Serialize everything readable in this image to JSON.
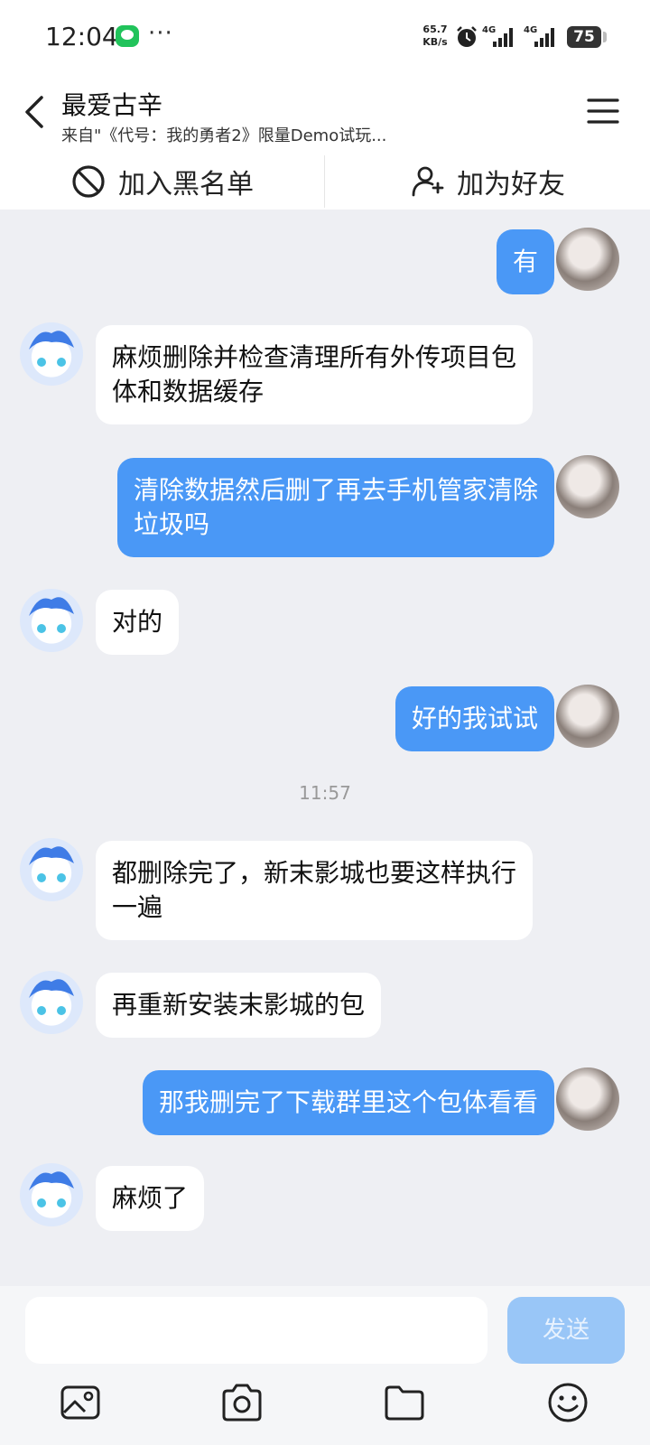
{
  "status_bar": {
    "time": "12:04",
    "more": "···",
    "net_speed_value": "65.7",
    "net_speed_unit": "KB/s",
    "signal1_label": "4G",
    "signal2_label": "4G",
    "battery": "75",
    "icons": [
      "wechat-notification-icon",
      "alarm-icon",
      "signal-icon",
      "battery-icon"
    ]
  },
  "header": {
    "title": "最爱古辛",
    "subtitle": "来自\"《代号：我的勇者2》限量Demo试玩...",
    "icons": [
      "back-icon",
      "menu-icon"
    ]
  },
  "actions": {
    "blacklist_label": "加入黑名单",
    "add_friend_label": "加为好友",
    "icons": [
      "block-icon",
      "add-friend-icon"
    ]
  },
  "messages": [
    {
      "sender": "me",
      "text": "有"
    },
    {
      "sender": "other",
      "text": "麻烦删除并检查清理所有外传项目包体和数据缓存"
    },
    {
      "sender": "me",
      "text": "清除数据然后删了再去手机管家清除垃圾吗"
    },
    {
      "sender": "other",
      "text": "对的"
    },
    {
      "sender": "me",
      "text": "好的我试试"
    },
    {
      "sender": "other",
      "text": "都删除完了，新末影城也要这样执行一遍"
    },
    {
      "sender": "other",
      "text": "再重新安装末影城的包"
    },
    {
      "sender": "me",
      "text": "那我删完了下载群里这个包体看看"
    },
    {
      "sender": "other",
      "text": "麻烦了"
    }
  ],
  "timestamp": "11:57",
  "input": {
    "placeholder": "",
    "send_label": "发送"
  },
  "toolbar_icons": [
    "image-icon",
    "camera-icon",
    "folder-icon",
    "emoji-icon"
  ],
  "colors": {
    "bubble_out": "#4a98f6",
    "bubble_in": "#ffffff",
    "chat_bg": "#eeeff3",
    "send_disabled": "#99c6f7"
  }
}
